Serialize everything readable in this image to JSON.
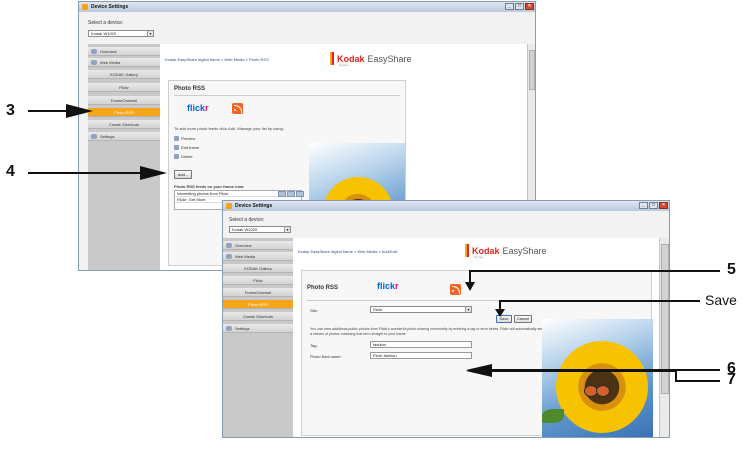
{
  "window1": {
    "title": "Device Settings",
    "select_label": "Select a device:",
    "device_value": "Kodak W1020",
    "nav": [
      {
        "label": "Overview"
      },
      {
        "label": "Web Media"
      },
      {
        "label": "KODAK Gallery"
      },
      {
        "label": "Flickr"
      },
      {
        "label": "FrameChannel"
      },
      {
        "label": "Photo RSS"
      },
      {
        "label": "Create Shortcuts"
      },
      {
        "label": "Settings"
      }
    ],
    "breadcrumb": "Kodak EasyShare digital frame » Web Media » Photo RSS",
    "brand": "Kodak",
    "brand_suffix": "EasyShare",
    "brand_system": "System",
    "panel_title": "Photo RSS",
    "flickr_blue": "flick",
    "flickr_pink": "r",
    "intro": "To add more photo feeds click Add. Manage your list by using:",
    "actions": [
      {
        "label": "Preview"
      },
      {
        "label": "Edit frame"
      },
      {
        "label": "Delete"
      }
    ],
    "add_label": "Add...",
    "feeds_title": "Photo RSS feeds on your frame now:",
    "feeds": [
      {
        "name": "Interesting photos from Flickr"
      },
      {
        "name": "Flickr: Get More"
      }
    ]
  },
  "window2": {
    "title": "Device Settings",
    "select_label": "Select a device:",
    "device_value": "Kodak W1020",
    "nav": [
      {
        "label": "Overview"
      },
      {
        "label": "Web Media"
      },
      {
        "label": "KODAK Gallery"
      },
      {
        "label": "Flickr"
      },
      {
        "label": "FrameChannel"
      },
      {
        "label": "Photo RSS"
      },
      {
        "label": "Create Shortcuts"
      },
      {
        "label": "Settings"
      }
    ],
    "breadcrumb": "Kodak EasyShare digital frame » Web Media » Add/Edit",
    "brand": "Kodak",
    "brand_suffix": "EasyShare",
    "brand_system": "System",
    "panel_title": "Photo RSS",
    "flickr_blue": "flick",
    "flickr_pink": "r",
    "site_label": "Site:",
    "site_value": "Flickr",
    "save_label": "Save",
    "cancel_label": "Cancel",
    "desc": "You can view additional public photos from Flickr's wonderful photo sharing community by entering a tag or term below. Flickr will automatically send a stream of photos matching that term straight to your frame.",
    "tag_label": "Tag:",
    "tag_value": "fashion",
    "feed_label": "Photo feed name:",
    "feed_value": "Flickr fashion"
  },
  "callouts": {
    "c3": "3",
    "c4": "4",
    "c5": "5",
    "c6": "6",
    "c7": "7",
    "save": "Save"
  },
  "colors": {
    "accent": "#f7a51c",
    "brand_red": "#e1261c",
    "flickr_blue": "#0063dc",
    "flickr_pink": "#ff0084"
  }
}
